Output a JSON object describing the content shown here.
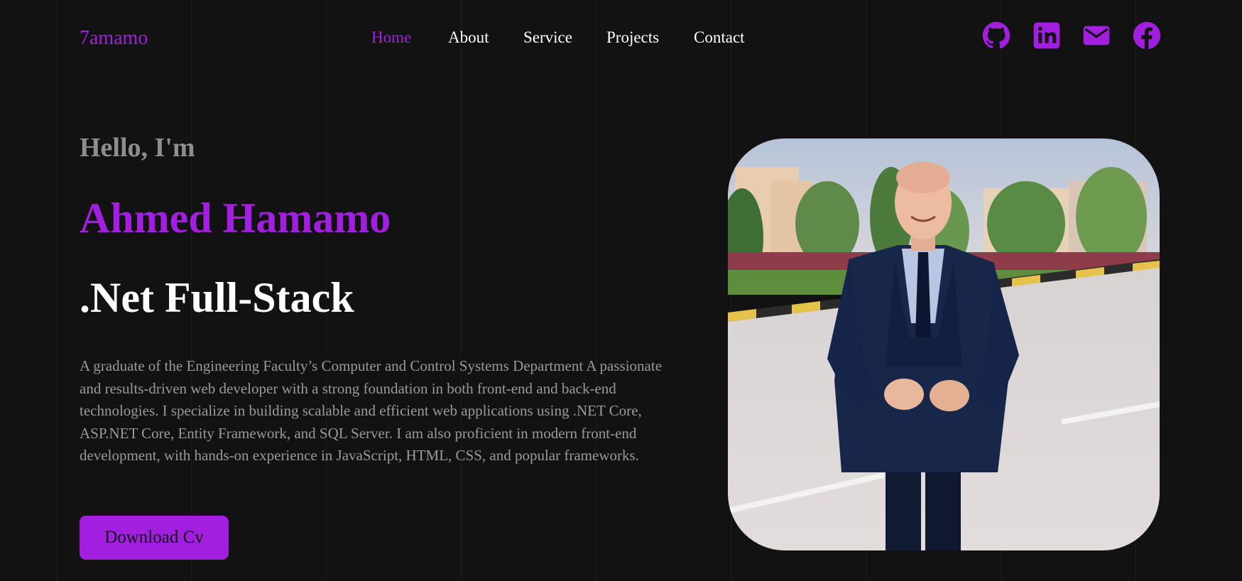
{
  "header": {
    "logo": "7amamo",
    "nav": [
      {
        "label": "Home",
        "active": true
      },
      {
        "label": "About",
        "active": false
      },
      {
        "label": "Service",
        "active": false
      },
      {
        "label": "Projects",
        "active": false
      },
      {
        "label": "Contact",
        "active": false
      }
    ],
    "social_icons": [
      "github-icon",
      "linkedin-icon",
      "email-icon",
      "facebook-icon"
    ]
  },
  "hero": {
    "greeting": "Hello, I'm",
    "name": "Ahmed Hamamo",
    "role": ".Net Full-Stack",
    "bio": "A graduate of the Engineering Faculty’s Computer and Control Systems Department A passionate and results-driven web developer with a strong foundation in both front-end and back-end technologies. I specialize in building scalable and efficient web applications using .NET Core, ASP.NET Core, Entity Framework, and SQL Server. I am also proficient in modern front-end development, with hands-on experience in JavaScript, HTML, CSS, and popular frameworks.",
    "cta_label": "Download Cv"
  },
  "colors": {
    "accent": "#a21fe0",
    "background": "#121212",
    "heading": "#ffffff",
    "muted": "#9a9a9a"
  }
}
